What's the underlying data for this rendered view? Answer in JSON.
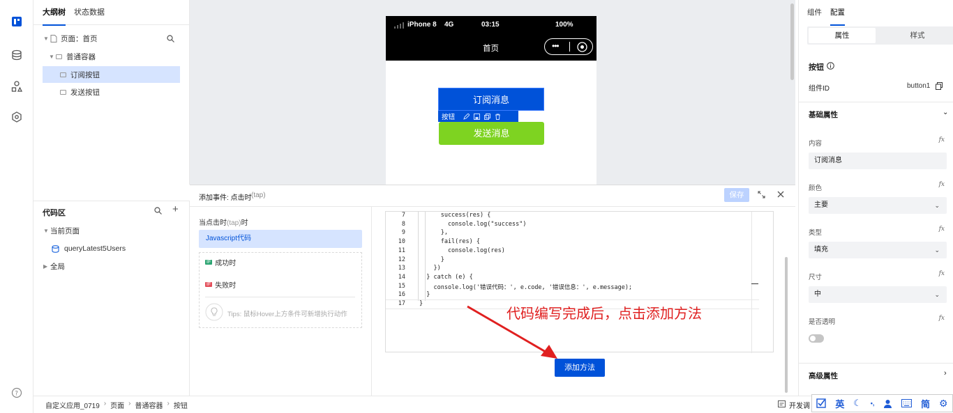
{
  "outline": {
    "tabs": [
      "大纲树",
      "状态数据"
    ],
    "nodes": [
      {
        "label": "页面：首页"
      },
      {
        "label": "普通容器"
      },
      {
        "label": "订阅按钮"
      },
      {
        "label": "发送按钮"
      }
    ]
  },
  "phone": {
    "device": "iPhone 8",
    "network": "4G",
    "time": "03:15",
    "battery": "100%",
    "page_title": "首页",
    "subscribe_button": "订阅消息",
    "send_button": "发送消息",
    "selected_tag": "按钮"
  },
  "code_area": {
    "title": "代码区",
    "current_page": "当前页面",
    "query_item": "queryLatest5Users",
    "global": "全局"
  },
  "event": {
    "title": "添加事件: 点击时",
    "title_tap": "(tap)",
    "save": "保存",
    "when_label": "当点击时",
    "when_tap": "(tap)",
    "when_suffix": "时",
    "js_item": "Javascript代码",
    "success_item": "成功时",
    "fail_item": "失败时",
    "if_badge": "IF",
    "tips": "Tips: 鼠标Hover上方条件可新增执行动作",
    "add_method": "添加方法",
    "annotation": "代码编写完成后，点击添加方法",
    "code_lines": [
      {
        "n": "7",
        "t": "      success(res) {"
      },
      {
        "n": "8",
        "t": "        console.log(\"success\")"
      },
      {
        "n": "9",
        "t": "      },"
      },
      {
        "n": "10",
        "t": "      fail(res) {"
      },
      {
        "n": "11",
        "t": "        console.log(res)"
      },
      {
        "n": "12",
        "t": "      }"
      },
      {
        "n": "13",
        "t": "    })"
      },
      {
        "n": "14",
        "t": "  } catch (e) {"
      },
      {
        "n": "15",
        "t": "    console.log('错误代码：', e.code, '错误信息：', e.message);"
      },
      {
        "n": "16",
        "t": "  }"
      },
      {
        "n": "17",
        "t": "}"
      }
    ]
  },
  "props": {
    "tabs": [
      "组件",
      "配置"
    ],
    "segments": [
      "属性",
      "样式"
    ],
    "component_name": "按钮",
    "id_label": "组件ID",
    "id_value": "button1",
    "basic_section": "基础属性",
    "fields": [
      {
        "label": "内容",
        "value": "订阅消息",
        "kind": "input"
      },
      {
        "label": "颜色",
        "value": "主要",
        "kind": "select"
      },
      {
        "label": "类型",
        "value": "填充",
        "kind": "select"
      },
      {
        "label": "尺寸",
        "value": "中",
        "kind": "select"
      },
      {
        "label": "是否透明",
        "value": "",
        "kind": "toggle"
      }
    ],
    "fx": "fx",
    "advanced_section": "高级属性"
  },
  "footer": {
    "breadcrumbs": [
      "自定义应用_0719",
      "页面",
      "普通容器",
      "按钮"
    ],
    "dev_label": "开发调"
  },
  "ime": {
    "lang": "英",
    "mode": "简"
  },
  "colors": {
    "primary": "#0052d9",
    "green": "#7ed321",
    "red_annotation": "#e02020"
  }
}
